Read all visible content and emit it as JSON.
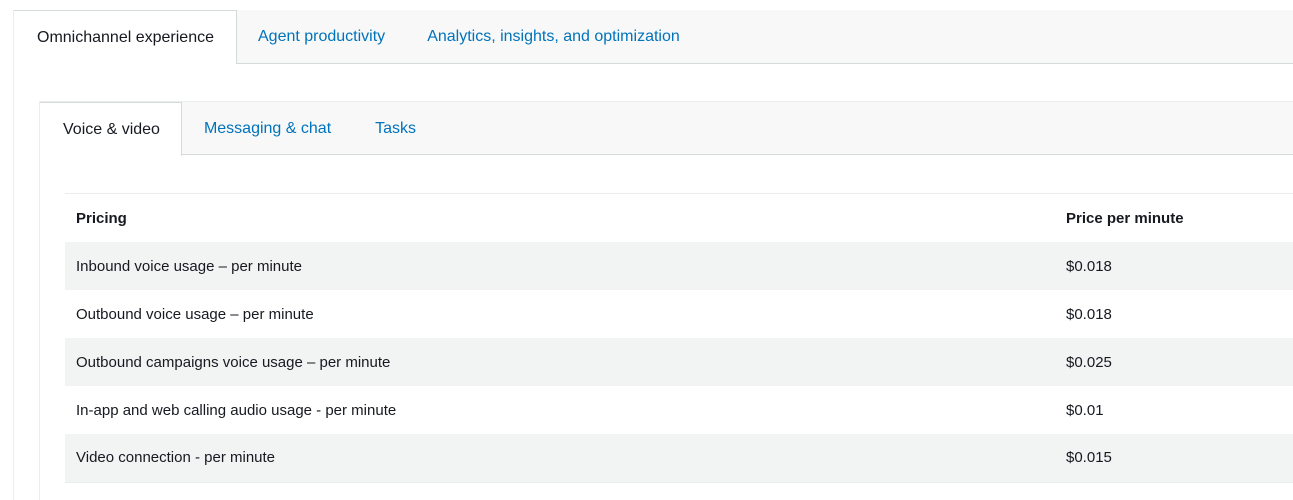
{
  "outer_tabs": [
    {
      "label": "Omnichannel experience",
      "active": true
    },
    {
      "label": "Agent productivity",
      "active": false
    },
    {
      "label": "Analytics, insights, and optimization",
      "active": false
    }
  ],
  "inner_tabs": [
    {
      "label": "Voice & video",
      "active": true
    },
    {
      "label": "Messaging & chat",
      "active": false
    },
    {
      "label": "Tasks",
      "active": false
    }
  ],
  "table": {
    "headers": [
      "Pricing",
      "Price per minute"
    ],
    "rows": [
      {
        "item": "Inbound voice usage – per minute",
        "price": "$0.018"
      },
      {
        "item": "Outbound voice usage – per minute",
        "price": "$0.018"
      },
      {
        "item": "Outbound campaigns voice usage – per minute",
        "price": "$0.025"
      },
      {
        "item": "In-app and web calling audio usage - per minute",
        "price": "$0.01"
      },
      {
        "item": "Video connection - per minute",
        "price": "$0.015"
      }
    ]
  },
  "colors": {
    "link": "#0073bb",
    "text": "#16191f",
    "tab_bar_bg": "#f8f8f8",
    "row_alt_bg": "#f2f3f3",
    "border": "#d5dbdb"
  }
}
